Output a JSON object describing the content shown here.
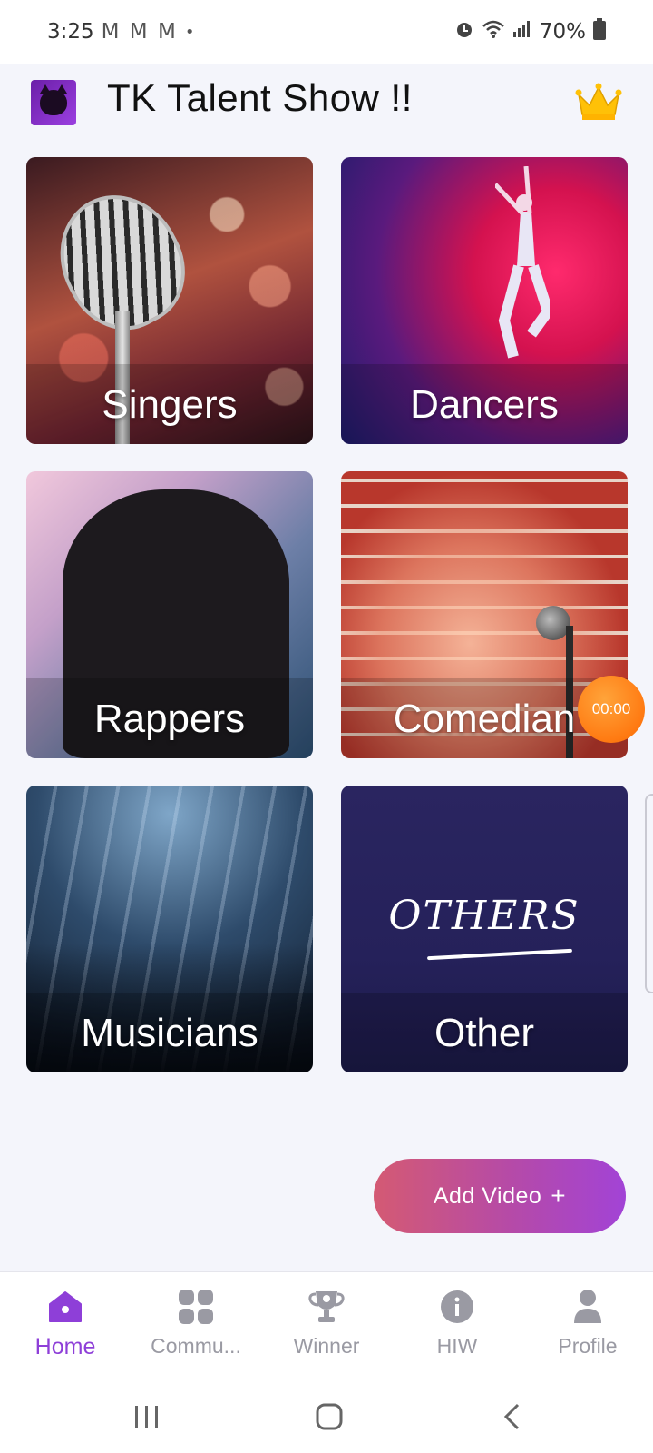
{
  "status_bar": {
    "time": "3:25",
    "notifications": "M M M",
    "dot": "•",
    "battery": "70%"
  },
  "header": {
    "title": "TK Talent Show !!",
    "logo_icon": "tk-cat-logo-icon",
    "premium_icon": "crown-icon"
  },
  "categories": [
    {
      "label": "Singers"
    },
    {
      "label": "Dancers"
    },
    {
      "label": "Rappers"
    },
    {
      "label": "Comedian"
    },
    {
      "label": "Musicians"
    },
    {
      "label": "Other"
    }
  ],
  "others_art_text": "OTHERS",
  "recording": {
    "timer": "00:00"
  },
  "add_video": {
    "label": "Add Video",
    "icon": "+"
  },
  "bottom_nav": [
    {
      "label": "Home",
      "icon": "home-icon",
      "active": true
    },
    {
      "label": "Commu...",
      "icon": "community-icon",
      "active": false
    },
    {
      "label": "Winner",
      "icon": "trophy-icon",
      "active": false
    },
    {
      "label": "HIW",
      "icon": "info-icon",
      "active": false
    },
    {
      "label": "Profile",
      "icon": "person-icon",
      "active": false
    }
  ],
  "colors": {
    "accent": "#8e3fd8",
    "add_video_start": "#d45a73",
    "add_video_end": "#a243d6",
    "recording": "#ff7a12"
  }
}
